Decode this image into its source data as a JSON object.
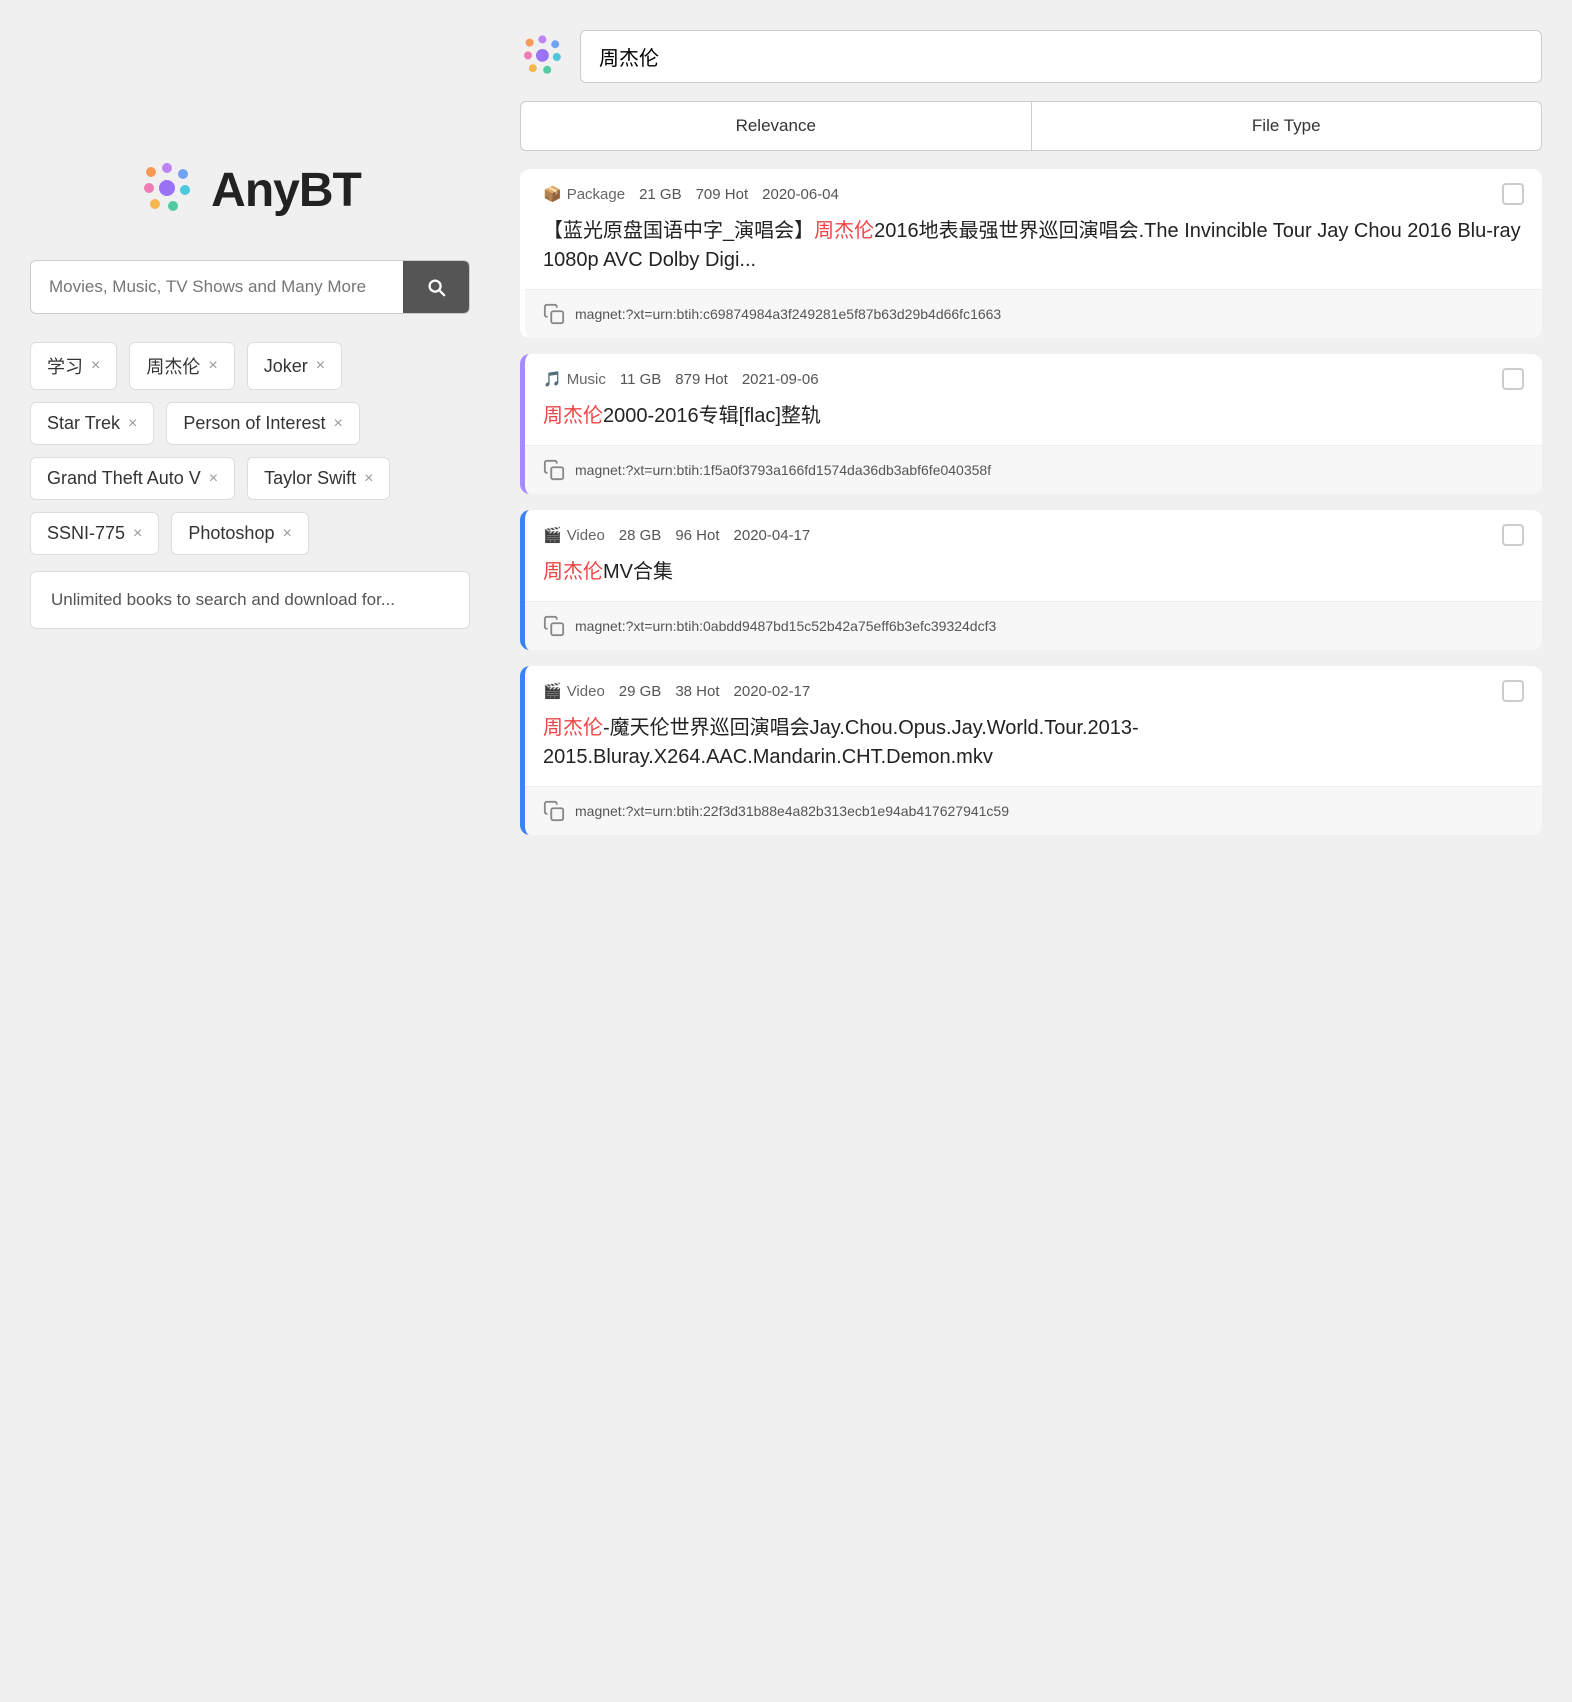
{
  "logo": {
    "text": "AnyBT"
  },
  "search": {
    "placeholder": "Movies, Music, TV Shows and Many More",
    "value": ""
  },
  "tags": [
    {
      "label": "学习",
      "id": "tag-xuexi"
    },
    {
      "label": "周杰伦",
      "id": "tag-zjl"
    },
    {
      "label": "Joker",
      "id": "tag-joker"
    },
    {
      "label": "Star Trek",
      "id": "tag-startrek"
    },
    {
      "label": "Person of Interest",
      "id": "tag-poi"
    },
    {
      "label": "Grand Theft Auto V",
      "id": "tag-gta"
    },
    {
      "label": "Taylor Swift",
      "id": "tag-taylor"
    },
    {
      "label": "SSNI-775",
      "id": "tag-ssni"
    },
    {
      "label": "Photoshop",
      "id": "tag-photoshop"
    }
  ],
  "unlimited_text": "Unlimited books to search and download for...",
  "right": {
    "search_value": "周杰伦",
    "filter_relevance": "Relevance",
    "filter_filetype": "File Type"
  },
  "results": [
    {
      "border": "no-border",
      "type_icon": "📦",
      "type_label": "Package",
      "size": "21 GB",
      "hot": "709 Hot",
      "date": "2020-06-04",
      "title_parts": [
        {
          "text": "【蓝光原盘国语中字_演唱会】",
          "highlight": false
        },
        {
          "text": "周杰伦",
          "highlight": true
        },
        {
          "text": "2016地表最强世界巡回演唱会.The Invincible Tour Jay Chou 2016 Blu-ray 1080p AVC Dolby Digi...",
          "highlight": false
        }
      ],
      "magnet": "magnet:?xt=urn:btih:c69874984a3f249281e5f87b63d29b4d66fc1663"
    },
    {
      "border": "purple-border",
      "type_icon": "🎵",
      "type_label": "Music",
      "size": "11 GB",
      "hot": "879 Hot",
      "date": "2021-09-06",
      "title_parts": [
        {
          "text": "周杰伦",
          "highlight": true
        },
        {
          "text": "2000-2016专辑[flac]整轨",
          "highlight": false
        }
      ],
      "magnet": "magnet:?xt=urn:btih:1f5a0f3793a166fd1574da36db3abf6fe040358f"
    },
    {
      "border": "blue-border",
      "type_icon": "🎬",
      "type_label": "Video",
      "size": "28 GB",
      "hot": "96 Hot",
      "date": "2020-04-17",
      "title_parts": [
        {
          "text": "周杰伦",
          "highlight": true
        },
        {
          "text": "MV合集",
          "highlight": false
        }
      ],
      "magnet": "magnet:?xt=urn:btih:0abdd9487bd15c52b42a75eff6b3efc39324dcf3"
    },
    {
      "border": "blue-border2",
      "type_icon": "🎬",
      "type_label": "Video",
      "size": "29 GB",
      "hot": "38 Hot",
      "date": "2020-02-17",
      "title_parts": [
        {
          "text": "周杰伦",
          "highlight": true
        },
        {
          "text": "-魔天伦世界巡回演唱会Jay.Chou.Opus.Jay.World.Tour.2013-2015.Bluray.X264.AAC.Mandarin.CHT.Demon.mkv",
          "highlight": false
        }
      ],
      "magnet": "magnet:?xt=urn:btih:22f3d31b88e4a82b313ecb1e94ab417627941c59"
    }
  ]
}
